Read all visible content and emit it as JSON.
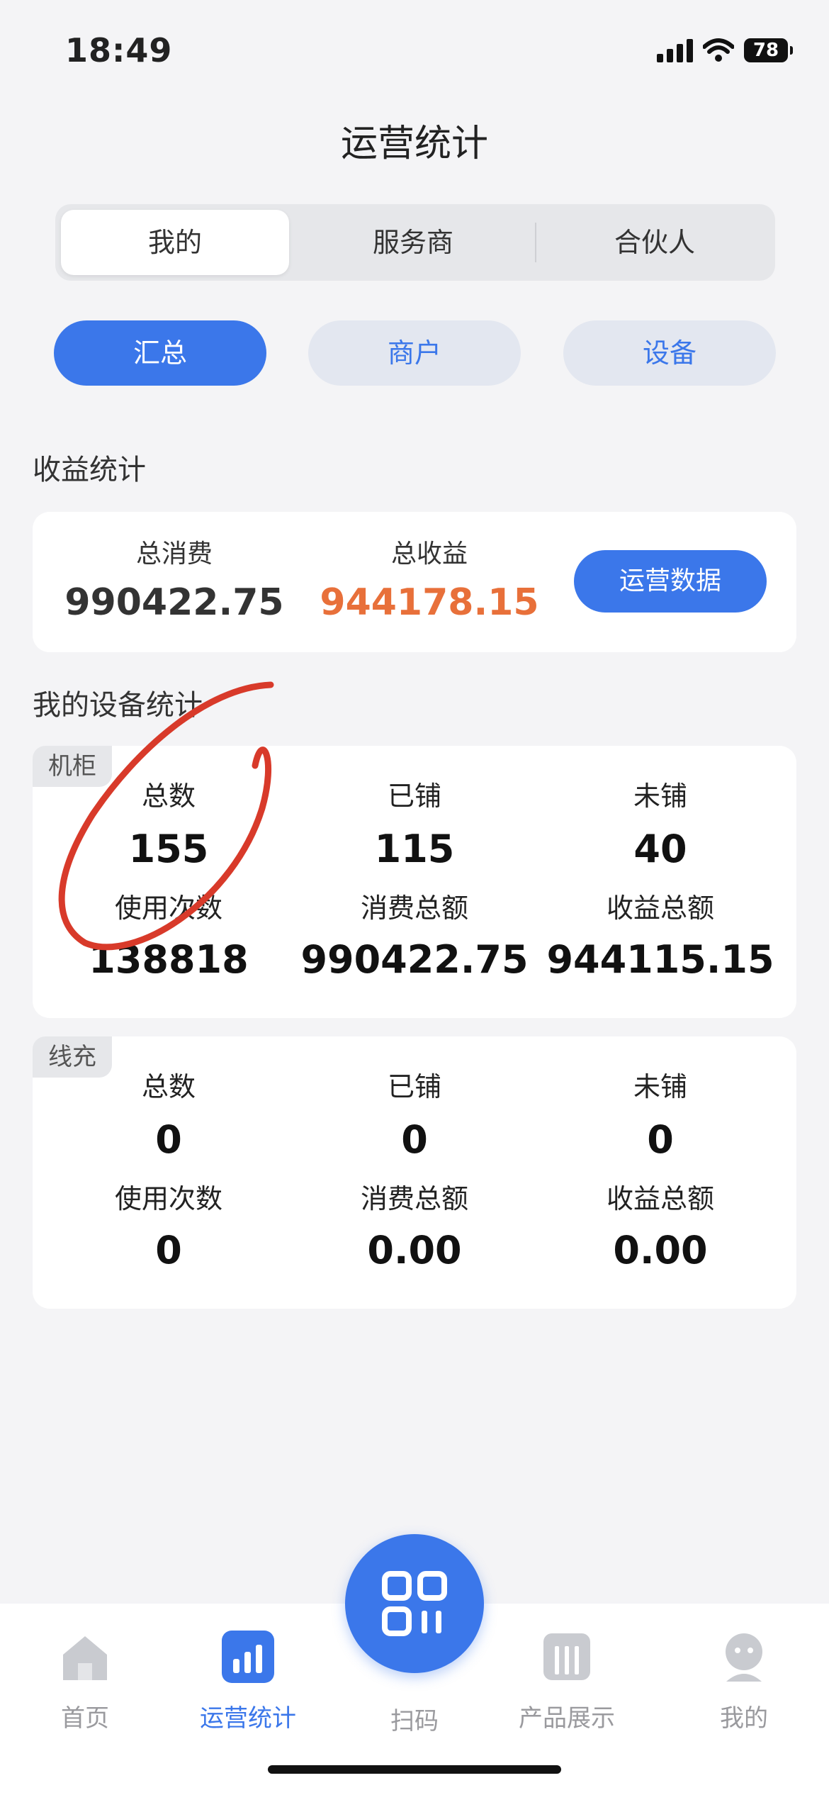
{
  "status": {
    "time": "18:49",
    "battery": "78"
  },
  "header": {
    "title": "运营统计"
  },
  "segment": {
    "items": [
      "我的",
      "服务商",
      "合伙人"
    ],
    "active": 0
  },
  "filters": {
    "items": [
      "汇总",
      "商户",
      "设备"
    ],
    "active": 0
  },
  "revenue": {
    "title": "收益统计",
    "total_consumption_label": "总消费",
    "total_consumption": "990422.75",
    "total_income_label": "总收益",
    "total_income": "944178.15",
    "button": "运营数据",
    "income_color": "#e8703a"
  },
  "devices": {
    "title": "我的设备统计",
    "cabinet": {
      "tag": "机柜",
      "cells": [
        {
          "label": "总数",
          "value": "155"
        },
        {
          "label": "已铺",
          "value": "115"
        },
        {
          "label": "未铺",
          "value": "40"
        },
        {
          "label": "使用次数",
          "value": "138818"
        },
        {
          "label": "消费总额",
          "value": "990422.75"
        },
        {
          "label": "收益总额",
          "value": "944115.15"
        }
      ]
    },
    "cable": {
      "tag": "线充",
      "cells": [
        {
          "label": "总数",
          "value": "0"
        },
        {
          "label": "已铺",
          "value": "0"
        },
        {
          "label": "未铺",
          "value": "0"
        },
        {
          "label": "使用次数",
          "value": "0"
        },
        {
          "label": "消费总额",
          "value": "0.00"
        },
        {
          "label": "收益总额",
          "value": "0.00"
        }
      ]
    }
  },
  "tabbar": {
    "items": [
      {
        "label": "首页",
        "icon": "home-icon"
      },
      {
        "label": "运营统计",
        "icon": "bar-chart-icon"
      },
      {
        "label": "扫码",
        "icon": "scan-icon"
      },
      {
        "label": "产品展示",
        "icon": "product-icon"
      },
      {
        "label": "我的",
        "icon": "profile-icon"
      }
    ],
    "active": 1
  },
  "colors": {
    "accent": "#3b77ea",
    "annotation": "#d83a2a"
  }
}
